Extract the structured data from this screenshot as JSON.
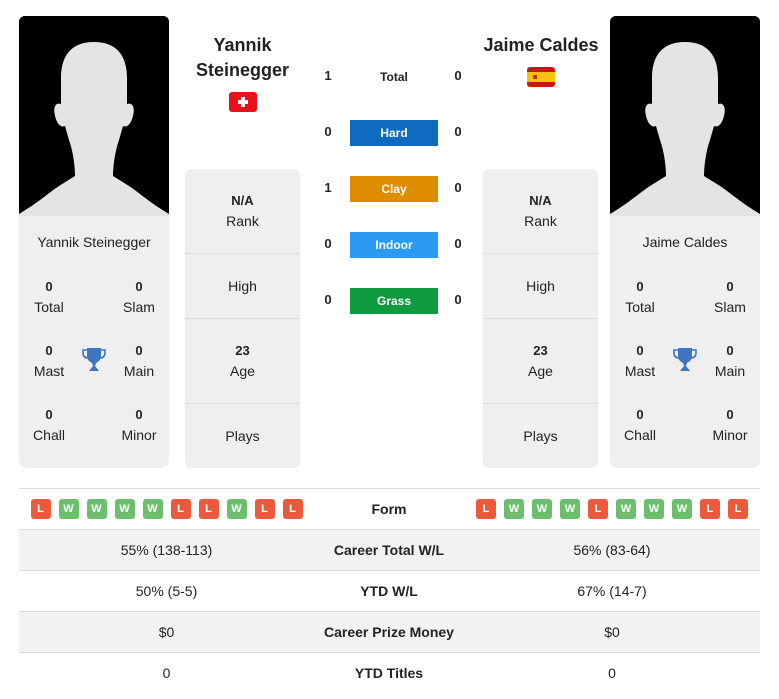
{
  "colors": {
    "hard": "#0e6bbf",
    "clay": "#de8d00",
    "indoor": "#2b9af3",
    "grass": "#0e9a3f",
    "win": "#6cbf6c",
    "loss": "#eb5a3c",
    "trophy": "#3f74c0"
  },
  "player1": {
    "name": "Yannik Steinegger",
    "header_line1": "Yannik",
    "header_line2": "Steinegger",
    "flag_icon": "switzerland-flag-icon",
    "titles": {
      "total": {
        "value": "0",
        "label": "Total"
      },
      "slam": {
        "value": "0",
        "label": "Slam"
      },
      "mast": {
        "value": "0",
        "label": "Mast"
      },
      "main": {
        "value": "0",
        "label": "Main"
      },
      "chall": {
        "value": "0",
        "label": "Chall"
      },
      "minor": {
        "value": "0",
        "label": "Minor"
      }
    },
    "rank": {
      "value": "N/A",
      "label": "Rank"
    },
    "high": {
      "label": "High"
    },
    "age": {
      "value": "23",
      "label": "Age"
    },
    "plays": {
      "label": "Plays"
    }
  },
  "player2": {
    "name": "Jaime Caldes",
    "header": "Jaime Caldes",
    "flag_icon": "spain-flag-icon",
    "titles": {
      "total": {
        "value": "0",
        "label": "Total"
      },
      "slam": {
        "value": "0",
        "label": "Slam"
      },
      "mast": {
        "value": "0",
        "label": "Mast"
      },
      "main": {
        "value": "0",
        "label": "Main"
      },
      "chall": {
        "value": "0",
        "label": "Chall"
      },
      "minor": {
        "value": "0",
        "label": "Minor"
      }
    },
    "rank": {
      "value": "N/A",
      "label": "Rank"
    },
    "high": {
      "label": "High"
    },
    "age": {
      "value": "23",
      "label": "Age"
    },
    "plays": {
      "label": "Plays"
    }
  },
  "h2h": [
    {
      "label": "Total",
      "p1": "1",
      "p2": "0"
    },
    {
      "label": "Hard",
      "p1": "0",
      "p2": "0"
    },
    {
      "label": "Clay",
      "p1": "1",
      "p2": "0"
    },
    {
      "label": "Indoor",
      "p1": "0",
      "p2": "0"
    },
    {
      "label": "Grass",
      "p1": "0",
      "p2": "0"
    }
  ],
  "comparison": {
    "form": {
      "label": "Form",
      "p1": [
        "L",
        "W",
        "W",
        "W",
        "W",
        "L",
        "L",
        "W",
        "L",
        "L"
      ],
      "p2": [
        "L",
        "W",
        "W",
        "W",
        "L",
        "W",
        "W",
        "W",
        "L",
        "L"
      ]
    },
    "rows": [
      {
        "label": "Career Total W/L",
        "p1": "55% (138-113)",
        "p2": "56% (83-64)"
      },
      {
        "label": "YTD W/L",
        "p1": "50% (5-5)",
        "p2": "67% (14-7)"
      },
      {
        "label": "Career Prize Money",
        "p1": "$0",
        "p2": "$0"
      },
      {
        "label": "YTD Titles",
        "p1": "0",
        "p2": "0"
      }
    ]
  }
}
